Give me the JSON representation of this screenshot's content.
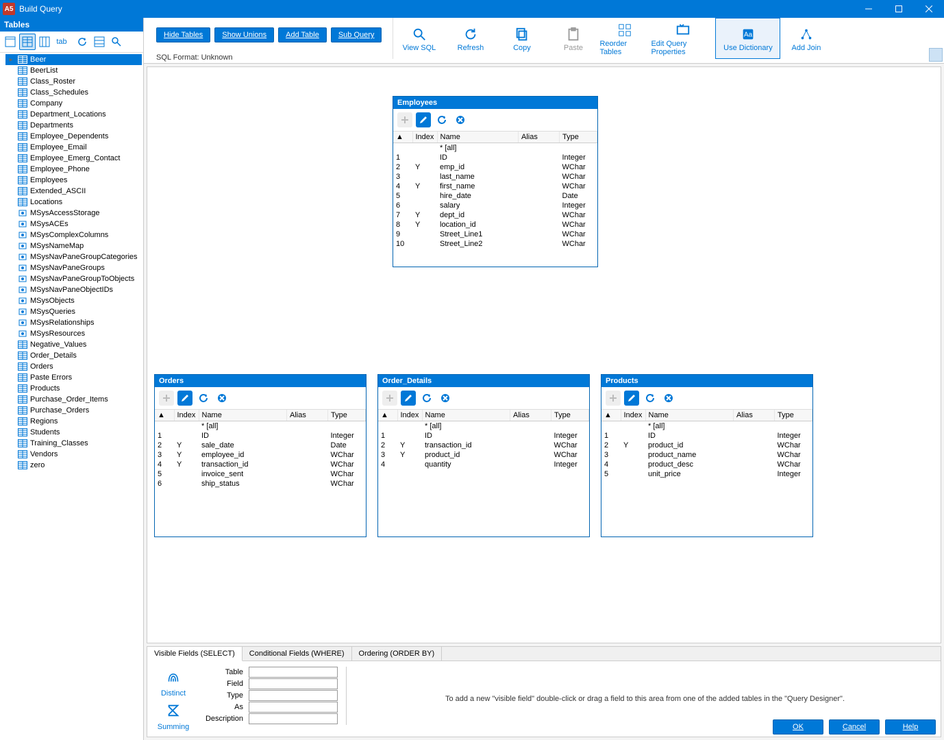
{
  "window": {
    "app_badge": "A5",
    "title": "Build Query"
  },
  "left": {
    "header": "Tables",
    "tools": [
      "grid-view",
      "table-view",
      "columns-view",
      "tab-view",
      "refresh",
      "tables-icon",
      "search"
    ],
    "items": [
      {
        "name": "Beer",
        "kind": "table",
        "selected": true
      },
      {
        "name": "BeerList",
        "kind": "table"
      },
      {
        "name": "Class_Roster",
        "kind": "table"
      },
      {
        "name": "Class_Schedules",
        "kind": "table"
      },
      {
        "name": "Company",
        "kind": "table"
      },
      {
        "name": "Department_Locations",
        "kind": "table"
      },
      {
        "name": "Departments",
        "kind": "table"
      },
      {
        "name": "Employee_Dependents",
        "kind": "table"
      },
      {
        "name": "Employee_Email",
        "kind": "table"
      },
      {
        "name": "Employee_Emerg_Contact",
        "kind": "table"
      },
      {
        "name": "Employee_Phone",
        "kind": "table"
      },
      {
        "name": "Employees",
        "kind": "table"
      },
      {
        "name": "Extended_ASCII",
        "kind": "table"
      },
      {
        "name": "Locations",
        "kind": "table"
      },
      {
        "name": "MSysAccessStorage",
        "kind": "sys"
      },
      {
        "name": "MSysACEs",
        "kind": "sys"
      },
      {
        "name": "MSysComplexColumns",
        "kind": "sys"
      },
      {
        "name": "MSysNameMap",
        "kind": "sys"
      },
      {
        "name": "MSysNavPaneGroupCategories",
        "kind": "sys"
      },
      {
        "name": "MSysNavPaneGroups",
        "kind": "sys"
      },
      {
        "name": "MSysNavPaneGroupToObjects",
        "kind": "sys"
      },
      {
        "name": "MSysNavPaneObjectIDs",
        "kind": "sys"
      },
      {
        "name": "MSysObjects",
        "kind": "sys"
      },
      {
        "name": "MSysQueries",
        "kind": "sys"
      },
      {
        "name": "MSysRelationships",
        "kind": "sys"
      },
      {
        "name": "MSysResources",
        "kind": "sys"
      },
      {
        "name": "Negative_Values",
        "kind": "table"
      },
      {
        "name": "Order_Details",
        "kind": "table"
      },
      {
        "name": "Orders",
        "kind": "table"
      },
      {
        "name": "Paste Errors",
        "kind": "table"
      },
      {
        "name": "Products",
        "kind": "table"
      },
      {
        "name": "Purchase_Order_Items",
        "kind": "table"
      },
      {
        "name": "Purchase_Orders",
        "kind": "table"
      },
      {
        "name": "Regions",
        "kind": "table"
      },
      {
        "name": "Students",
        "kind": "table"
      },
      {
        "name": "Training_Classes",
        "kind": "table"
      },
      {
        "name": "Vendors",
        "kind": "table"
      },
      {
        "name": "zero",
        "kind": "table"
      }
    ]
  },
  "top_buttons": {
    "hide_tables": "Hide Tables",
    "show_unions": "Show Unions",
    "add_table": "Add Table",
    "sub_query": "Sub Query"
  },
  "big_toolbar": [
    {
      "id": "view-sql",
      "label": "View SQL",
      "icon": "search"
    },
    {
      "id": "refresh",
      "label": "Refresh",
      "icon": "refresh"
    },
    {
      "id": "copy",
      "label": "Copy",
      "icon": "copy"
    },
    {
      "id": "paste",
      "label": "Paste",
      "icon": "paste",
      "disabled": true
    },
    {
      "id": "reorder",
      "label": "Reorder Tables",
      "icon": "reorder"
    },
    {
      "id": "edit-props",
      "label": "Edit Query Properties",
      "icon": "props"
    },
    {
      "id": "use-dict",
      "label": "Use Dictionary",
      "icon": "dict",
      "active": true
    },
    {
      "id": "add-join",
      "label": "Add Join",
      "icon": "join"
    }
  ],
  "status": "SQL Format: Unknown",
  "tables": {
    "employees": {
      "title": "Employees",
      "headers": {
        "sort": "▲",
        "index": "Index",
        "name": "Name",
        "alias": "Alias",
        "type": "Type"
      },
      "rows": [
        {
          "n": "",
          "idx": "",
          "name": "* [all]",
          "alias": "",
          "type": ""
        },
        {
          "n": "1",
          "idx": "",
          "name": "ID",
          "alias": "",
          "type": "Integer"
        },
        {
          "n": "2",
          "idx": "Y",
          "name": "emp_id",
          "alias": "",
          "type": "WChar"
        },
        {
          "n": "3",
          "idx": "",
          "name": "last_name",
          "alias": "",
          "type": "WChar"
        },
        {
          "n": "4",
          "idx": "Y",
          "name": "first_name",
          "alias": "",
          "type": "WChar"
        },
        {
          "n": "5",
          "idx": "",
          "name": "hire_date",
          "alias": "",
          "type": "Date"
        },
        {
          "n": "6",
          "idx": "",
          "name": "salary",
          "alias": "",
          "type": "Integer"
        },
        {
          "n": "7",
          "idx": "Y",
          "name": "dept_id",
          "alias": "",
          "type": "WChar"
        },
        {
          "n": "8",
          "idx": "Y",
          "name": "location_id",
          "alias": "",
          "type": "WChar"
        },
        {
          "n": "9",
          "idx": "",
          "name": "Street_Line1",
          "alias": "",
          "type": "WChar"
        },
        {
          "n": "10",
          "idx": "",
          "name": "Street_Line2",
          "alias": "",
          "type": "WChar"
        }
      ]
    },
    "orders": {
      "title": "Orders",
      "rows": [
        {
          "n": "",
          "idx": "",
          "name": "* [all]",
          "alias": "",
          "type": ""
        },
        {
          "n": "1",
          "idx": "",
          "name": "ID",
          "alias": "",
          "type": "Integer"
        },
        {
          "n": "2",
          "idx": "Y",
          "name": "sale_date",
          "alias": "",
          "type": "Date"
        },
        {
          "n": "3",
          "idx": "Y",
          "name": "employee_id",
          "alias": "",
          "type": "WChar"
        },
        {
          "n": "4",
          "idx": "Y",
          "name": "transaction_id",
          "alias": "",
          "type": "WChar"
        },
        {
          "n": "5",
          "idx": "",
          "name": "invoice_sent",
          "alias": "",
          "type": "WChar"
        },
        {
          "n": "6",
          "idx": "",
          "name": "ship_status",
          "alias": "",
          "type": "WChar"
        }
      ]
    },
    "order_details": {
      "title": "Order_Details",
      "rows": [
        {
          "n": "",
          "idx": "",
          "name": "* [all]",
          "alias": "",
          "type": ""
        },
        {
          "n": "1",
          "idx": "",
          "name": "ID",
          "alias": "",
          "type": "Integer"
        },
        {
          "n": "2",
          "idx": "Y",
          "name": "transaction_id",
          "alias": "",
          "type": "WChar"
        },
        {
          "n": "3",
          "idx": "Y",
          "name": "product_id",
          "alias": "",
          "type": "WChar"
        },
        {
          "n": "4",
          "idx": "",
          "name": "quantity",
          "alias": "",
          "type": "Integer"
        }
      ]
    },
    "products": {
      "title": "Products",
      "rows": [
        {
          "n": "",
          "idx": "",
          "name": "* [all]",
          "alias": "",
          "type": ""
        },
        {
          "n": "1",
          "idx": "",
          "name": "ID",
          "alias": "",
          "type": "Integer"
        },
        {
          "n": "2",
          "idx": "Y",
          "name": "product_id",
          "alias": "",
          "type": "WChar"
        },
        {
          "n": "3",
          "idx": "",
          "name": "product_name",
          "alias": "",
          "type": "WChar"
        },
        {
          "n": "4",
          "idx": "",
          "name": "product_desc",
          "alias": "",
          "type": "WChar"
        },
        {
          "n": "5",
          "idx": "",
          "name": "unit_price",
          "alias": "",
          "type": "Integer"
        }
      ]
    }
  },
  "bottom": {
    "tabs": {
      "visible": "Visible Fields (SELECT)",
      "conditional": "Conditional Fields (WHERE)",
      "ordering": "Ordering (ORDER BY)"
    },
    "icons": {
      "distinct": "Distinct",
      "summing": "Summing"
    },
    "form": {
      "table": "Table",
      "field": "Field",
      "type": "Type",
      "as": "As",
      "description": "Description"
    },
    "hint": "To add a new \"visible field\" double-click or drag a field to this area from one of the added tables in the \"Query Designer\"."
  },
  "dialog": {
    "ok": "OK",
    "cancel": "Cancel",
    "help": "Help"
  }
}
